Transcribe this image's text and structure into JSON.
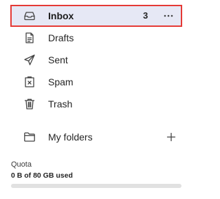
{
  "folders": {
    "inbox": {
      "label": "Inbox",
      "count": "3",
      "icon": "inbox-icon"
    },
    "drafts": {
      "label": "Drafts",
      "icon": "drafts-icon"
    },
    "sent": {
      "label": "Sent",
      "icon": "send-icon"
    },
    "spam": {
      "label": "Spam",
      "icon": "spam-icon"
    },
    "trash": {
      "label": "Trash",
      "icon": "trash-icon"
    },
    "my_folders": {
      "label": "My folders",
      "icon": "folder-icon"
    }
  },
  "quota": {
    "label": "Quota",
    "usage_text": "0 B of 80 GB used",
    "used_fraction": 0
  },
  "colors": {
    "selected_background": "#e6e8f5",
    "selected_outline": "#e53935",
    "quota_track": "#e1e1e1"
  }
}
